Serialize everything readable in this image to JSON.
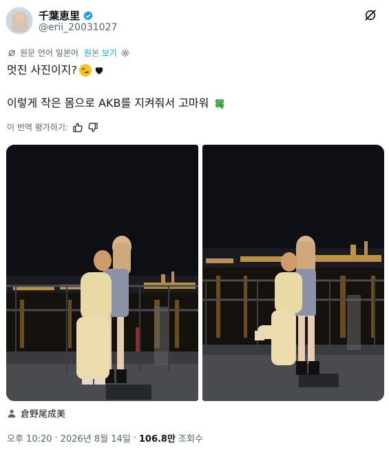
{
  "author": {
    "display_name": "千葉恵里",
    "handle": "@erii_20031027",
    "verified_icon": "verified-badge-icon",
    "colors": {
      "verified": "#1d9bf0"
    }
  },
  "translation": {
    "notice": "원문 언어 일본어",
    "show_original": "원본 보기"
  },
  "post": {
    "line1": "멋진 사진이지?",
    "line2": "이렇게 작은 몸으로 AKB를 지켜줘서 고마워",
    "emojis": [
      "smirk-emoji",
      "black-heart-emoji",
      "four-leaf-clover-emoji"
    ]
  },
  "rate": {
    "label": "이 번역 평가하기:"
  },
  "media": {
    "count": 2
  },
  "credit": {
    "name": "倉野尾成美"
  },
  "meta": {
    "time": "오후 10:20",
    "date": "2026년 8월 14일",
    "separator": "·",
    "views": "106.8만",
    "views_label": "조회수"
  },
  "colors": {
    "link": "#1d9bf0",
    "muted": "#536471",
    "text": "#0f1419"
  }
}
